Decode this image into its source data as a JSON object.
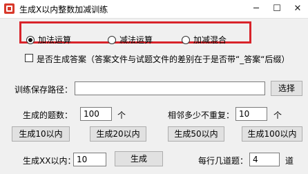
{
  "window": {
    "title": "生成X以内整数加减训练",
    "minimize_glyph": "─",
    "maximize_glyph": "☐",
    "close_glyph": "✕",
    "app_icon": "app-icon"
  },
  "operation_mode": {
    "options": [
      "加法运算",
      "减法运算",
      "加减混合"
    ],
    "selected": "加法运算",
    "highlight_color": "#d8232a"
  },
  "generate_answers": {
    "label": "是否生成答案（答案文件与试题文件的差别在于是否带“_答案“后缀）",
    "checked": false
  },
  "save_path": {
    "label": "训练保存路径：",
    "value": "",
    "browse_label": "选择"
  },
  "question_count": {
    "label": "生成的题数：",
    "value": "100",
    "unit": "个"
  },
  "no_repeat": {
    "label": "相邻多少不重复：",
    "value": "10",
    "unit": "个"
  },
  "preset_buttons": [
    "生成10以内",
    "生成20以内",
    "生成50以内",
    "生成100以内"
  ],
  "custom_range": {
    "label": "生成XX以内：",
    "value": "10",
    "button_label": "生成"
  },
  "per_row": {
    "label": "每行几道题：",
    "value": "4",
    "unit": "道"
  }
}
